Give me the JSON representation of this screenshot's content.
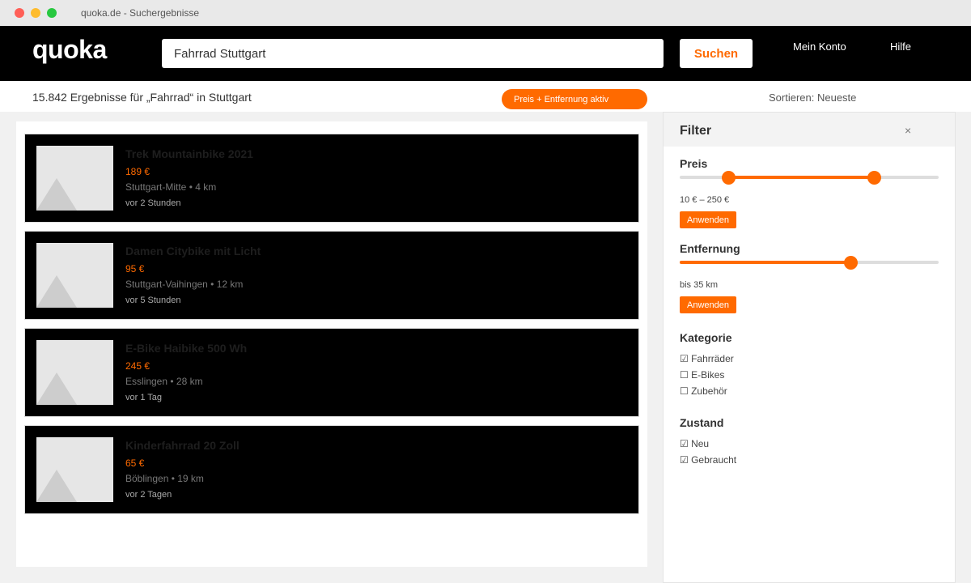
{
  "window": {
    "title": "quoka.de - Suchergebnisse"
  },
  "header": {
    "logo": "quoka",
    "search_value": "Fahrrad Stuttgart",
    "search_button": "Suchen",
    "nav": {
      "account": "Mein Konto",
      "help": "Hilfe"
    }
  },
  "results": {
    "count_text": "15.842 Ergebnisse für „Fahrrad“ in Stuttgart",
    "active_filter_chip": "Preis + Entfernung aktiv",
    "sort_label": "Sortieren: Neueste"
  },
  "listings": [
    {
      "title": "Trek Mountainbike 2021",
      "price": "189 €",
      "location": "Stuttgart-Mitte • 4 km",
      "time": "vor 2 Stunden"
    },
    {
      "title": "Damen Citybike mit Licht",
      "price": "95 €",
      "location": "Stuttgart-Vaihingen • 12 km",
      "time": "vor 5 Stunden"
    },
    {
      "title": "E-Bike Haibike 500 Wh",
      "price": "245 €",
      "location": "Esslingen • 28 km",
      "time": "vor 1 Tag"
    },
    {
      "title": "Kinderfahrrad 20 Zoll",
      "price": "65 €",
      "location": "Böblingen • 19 km",
      "time": "vor 2 Tagen"
    }
  ],
  "filter": {
    "title": "Filter",
    "close": "×",
    "price": {
      "label": "Preis",
      "range_text": "10 € – 250 €",
      "apply": "Anwenden",
      "min_value": 10,
      "max_value": 250,
      "slider_min": 0,
      "slider_max": 320
    },
    "distance": {
      "label": "Entfernung",
      "range_text": "bis 35 km",
      "apply": "Anwenden",
      "value": 35,
      "slider_max": 53
    },
    "category": {
      "label": "Kategorie",
      "options": [
        {
          "label": "☑ Fahrräder",
          "checked": true
        },
        {
          "label": "☐ E-Bikes",
          "checked": false
        },
        {
          "label": "☐ Zubehör",
          "checked": false
        }
      ]
    },
    "condition": {
      "label": "Zustand",
      "options": [
        {
          "label": "☑ Neu",
          "checked": true
        },
        {
          "label": "☑ Gebraucht",
          "checked": true
        }
      ]
    }
  },
  "colors": {
    "accent": "#ff6a00",
    "header_bg": "#000000",
    "card_bg": "#000000"
  },
  "icons": {
    "close": "close-icon",
    "thumbnail": "image-placeholder-icon"
  }
}
